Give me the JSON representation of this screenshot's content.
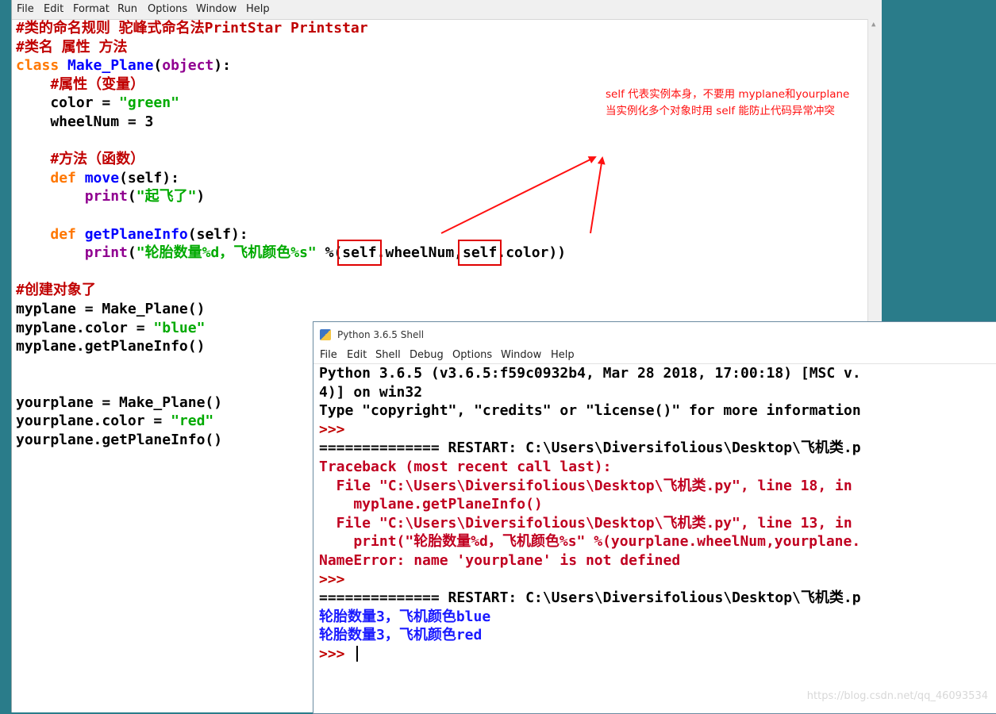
{
  "editor": {
    "menu": [
      "File",
      "Edit",
      "Format",
      "Run",
      "Options",
      "Window",
      "Help"
    ],
    "code": [
      [
        {
          "t": "#类的命名规则 驼峰式命名法PrintStar Printstar",
          "c": "cm"
        }
      ],
      [
        {
          "t": "#类名 属性 方法",
          "c": "cm"
        }
      ],
      [
        {
          "t": "class ",
          "c": "kw"
        },
        {
          "t": "Make_Plane",
          "c": "fn"
        },
        {
          "t": "(",
          "c": ""
        },
        {
          "t": "object",
          "c": "bi"
        },
        {
          "t": "):",
          "c": ""
        }
      ],
      [
        {
          "t": "    #属性（变量）",
          "c": "cm"
        }
      ],
      [
        {
          "t": "    color = ",
          "c": ""
        },
        {
          "t": "\"green\"",
          "c": "st"
        }
      ],
      [
        {
          "t": "    wheelNum = 3",
          "c": ""
        }
      ],
      [
        {
          "t": "",
          "c": ""
        }
      ],
      [
        {
          "t": "    #方法（函数）",
          "c": "cm"
        }
      ],
      [
        {
          "t": "    ",
          "c": ""
        },
        {
          "t": "def ",
          "c": "kw"
        },
        {
          "t": "move",
          "c": "fn"
        },
        {
          "t": "(self):",
          "c": ""
        }
      ],
      [
        {
          "t": "        ",
          "c": ""
        },
        {
          "t": "print",
          "c": "bi"
        },
        {
          "t": "(",
          "c": ""
        },
        {
          "t": "\"起飞了\"",
          "c": "st"
        },
        {
          "t": ")",
          "c": ""
        }
      ],
      [
        {
          "t": "",
          "c": ""
        }
      ],
      [
        {
          "t": "    ",
          "c": ""
        },
        {
          "t": "def ",
          "c": "kw"
        },
        {
          "t": "getPlaneInfo",
          "c": "fn"
        },
        {
          "t": "(self):",
          "c": ""
        }
      ],
      [
        {
          "t": "        ",
          "c": ""
        },
        {
          "t": "print",
          "c": "bi"
        },
        {
          "t": "(",
          "c": ""
        },
        {
          "t": "\"轮胎数量%d，飞机颜色%s\"",
          "c": "st"
        },
        {
          "t": " %(",
          "c": ""
        },
        {
          "t": "self",
          "c": "box"
        },
        {
          "t": ".wheelNum,",
          "c": ""
        },
        {
          "t": "self",
          "c": "box"
        },
        {
          "t": ".color))",
          "c": ""
        }
      ],
      [
        {
          "t": "",
          "c": ""
        }
      ],
      [
        {
          "t": "#创建对象了",
          "c": "cm"
        }
      ],
      [
        {
          "t": "myplane = Make_Plane()",
          "c": ""
        }
      ],
      [
        {
          "t": "myplane.color = ",
          "c": ""
        },
        {
          "t": "\"blue\"",
          "c": "st"
        }
      ],
      [
        {
          "t": "myplane.getPlaneInfo()",
          "c": ""
        }
      ],
      [
        {
          "t": "",
          "c": ""
        }
      ],
      [
        {
          "t": "",
          "c": ""
        }
      ],
      [
        {
          "t": "yourplane = Make_Plane()",
          "c": ""
        }
      ],
      [
        {
          "t": "yourplane.color = ",
          "c": ""
        },
        {
          "t": "\"red\"",
          "c": "st"
        }
      ],
      [
        {
          "t": "yourplane.getPlaneInfo()",
          "c": ""
        }
      ]
    ]
  },
  "annotation": {
    "line1": "self 代表实例本身，不要用 myplane和yourplane",
    "line2": "当实例化多个对象时用 self 能防止代码异常冲突"
  },
  "shell": {
    "title": "Python 3.6.5 Shell",
    "menu": [
      "File",
      "Edit",
      "Shell",
      "Debug",
      "Options",
      "Window",
      "Help"
    ],
    "lines": [
      [
        {
          "t": "Python 3.6.5 (v3.6.5:f59c0932b4, Mar 28 2018, 17:00:18) [MSC v.",
          "c": ""
        }
      ],
      [
        {
          "t": "4)] on win32",
          "c": ""
        }
      ],
      [
        {
          "t": "Type \"copyright\", \"credits\" or \"license()\" for more information",
          "c": ""
        }
      ],
      [
        {
          "t": ">>> ",
          "c": "prompt"
        }
      ],
      [
        {
          "t": "============== RESTART: C:\\Users\\Diversifolious\\Desktop\\飞机类.p",
          "c": ""
        }
      ],
      [
        {
          "t": "Traceback (most recent call last):",
          "c": "err"
        }
      ],
      [
        {
          "t": "  File \"C:\\Users\\Diversifolious\\Desktop\\飞机类.py\", line 18, in",
          "c": "err"
        }
      ],
      [
        {
          "t": "    myplane.getPlaneInfo()",
          "c": "err"
        }
      ],
      [
        {
          "t": "  File \"C:\\Users\\Diversifolious\\Desktop\\飞机类.py\", line 13, in",
          "c": "err"
        }
      ],
      [
        {
          "t": "    print(\"轮胎数量%d，飞机颜色%s\" %(yourplane.wheelNum,yourplane.",
          "c": "err"
        }
      ],
      [
        {
          "t": "NameError: name 'yourplane' is not defined",
          "c": "err"
        }
      ],
      [
        {
          "t": ">>> ",
          "c": "prompt"
        }
      ],
      [
        {
          "t": "============== RESTART: C:\\Users\\Diversifolious\\Desktop\\飞机类.p",
          "c": ""
        }
      ],
      [
        {
          "t": "轮胎数量3，飞机颜色blue",
          "c": "out"
        }
      ],
      [
        {
          "t": "轮胎数量3，飞机颜色red",
          "c": "out"
        }
      ],
      [
        {
          "t": ">>> ",
          "c": "prompt"
        }
      ]
    ]
  },
  "watermark": "https://blog.csdn.net/qq_46093534",
  "colors": {
    "desktop": "#2a7c8a",
    "comment": "#c00000",
    "keyword": "#ff7700",
    "function": "#0000ff",
    "string": "#00aa00",
    "builtin": "#900090",
    "error": "#c00020",
    "output": "#1a1aff",
    "annotation": "#ff1010"
  }
}
